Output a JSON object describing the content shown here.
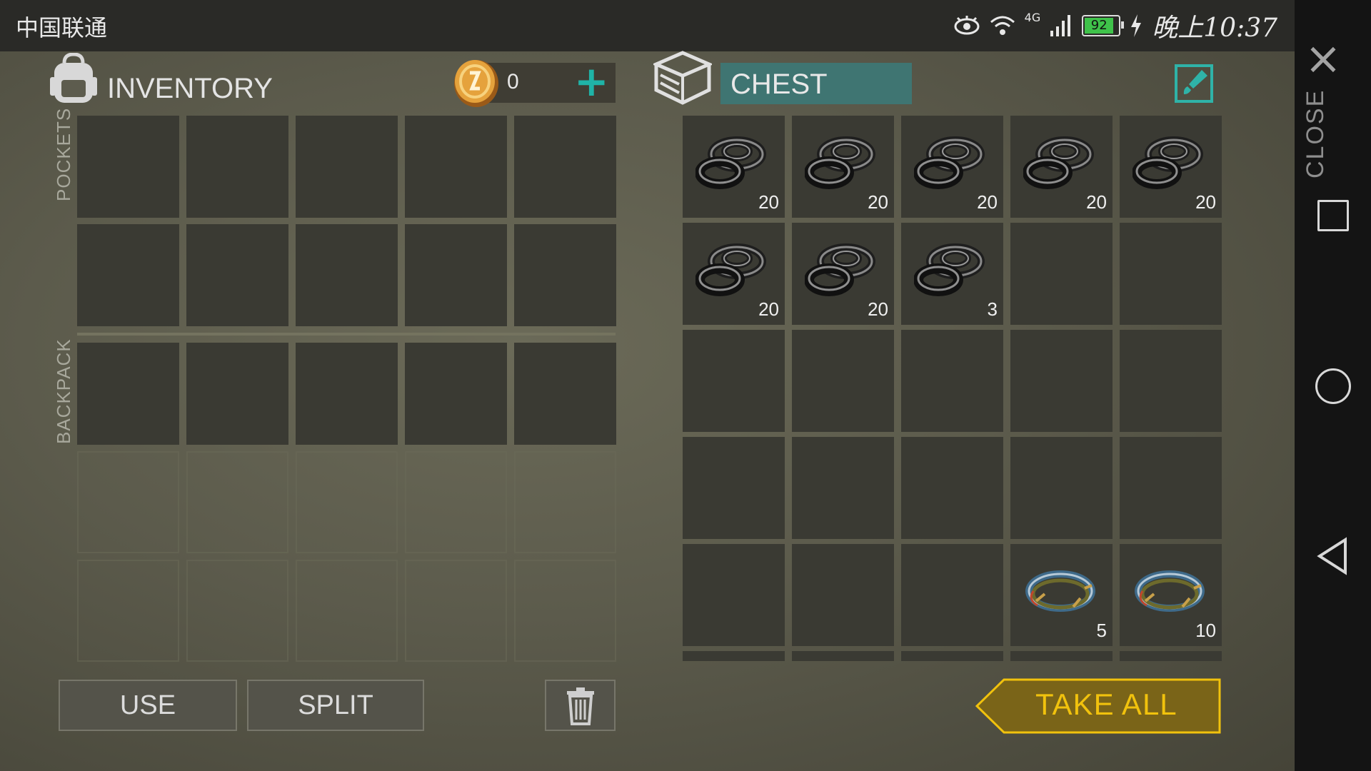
{
  "status_bar": {
    "carrier": "中国联通",
    "network": "4G",
    "battery": "92",
    "time": "晚上10:37",
    "icons": [
      "eye-icon",
      "wifi-icon",
      "signal-icon",
      "battery-icon",
      "charging-icon"
    ]
  },
  "inventory": {
    "title": "INVENTORY",
    "coins": "0",
    "sections": {
      "pockets": "POCKETS",
      "backpack": "BACKPACK"
    }
  },
  "chest": {
    "title": "CHEST",
    "rows": [
      [
        {
          "item": "rope-icon",
          "qty": "20"
        },
        {
          "item": "rope-icon",
          "qty": "20"
        },
        {
          "item": "rope-icon",
          "qty": "20"
        },
        {
          "item": "rope-icon",
          "qty": "20"
        },
        {
          "item": "rope-icon",
          "qty": "20"
        }
      ],
      [
        {
          "item": "rope-icon",
          "qty": "20"
        },
        {
          "item": "rope-icon",
          "qty": "20"
        },
        {
          "item": "rope-icon",
          "qty": "3"
        },
        {
          "item": null,
          "qty": ""
        },
        {
          "item": null,
          "qty": ""
        }
      ],
      [
        {
          "item": null,
          "qty": ""
        },
        {
          "item": null,
          "qty": ""
        },
        {
          "item": null,
          "qty": ""
        },
        {
          "item": null,
          "qty": ""
        },
        {
          "item": null,
          "qty": ""
        }
      ],
      [
        {
          "item": null,
          "qty": ""
        },
        {
          "item": null,
          "qty": ""
        },
        {
          "item": null,
          "qty": ""
        },
        {
          "item": null,
          "qty": ""
        },
        {
          "item": null,
          "qty": ""
        }
      ],
      [
        {
          "item": null,
          "qty": ""
        },
        {
          "item": null,
          "qty": ""
        },
        {
          "item": null,
          "qty": ""
        },
        {
          "item": "wire-coil-icon",
          "qty": "5"
        },
        {
          "item": "wire-coil-icon",
          "qty": "10"
        }
      ]
    ]
  },
  "buttons": {
    "use": "USE",
    "split": "SPLIT",
    "take_all": "TAKE ALL"
  },
  "side": {
    "close": "CLOSE"
  },
  "colors": {
    "accent": "#2fb3a8",
    "take_all": "#f1c20d",
    "chest_header": "#3f7572"
  }
}
